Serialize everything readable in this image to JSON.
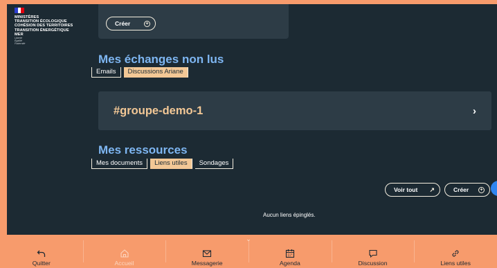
{
  "logo": {
    "lines": [
      "MINISTÈRES",
      "TRANSITION ÉCOLOGIQUE",
      "COHÉSION DES TERRITOIRES",
      "TRANSITION ÉNERGÉTIQUE",
      "MER"
    ],
    "motto": [
      "Liberté",
      "Égalité",
      "Fraternité"
    ],
    "flag_colors": [
      "#2d3fd1",
      "#ffffff",
      "#e1000f"
    ]
  },
  "top_card": {
    "create_label": "Créer"
  },
  "unread": {
    "title": "Mes échanges non lus",
    "tabs": [
      {
        "label": "Emails",
        "active": false
      },
      {
        "label": "Discussions Ariane",
        "active": true
      }
    ],
    "group_name": "#groupe-demo-1"
  },
  "resources": {
    "title": "Mes ressources",
    "tabs": [
      {
        "label": "Mes documents",
        "active": false
      },
      {
        "label": "Liens utiles",
        "active": true
      },
      {
        "label": "Sondages",
        "active": false
      }
    ],
    "view_all_label": "Voir tout",
    "create_label": "Créer",
    "empty_message": "Aucun liens épinglés."
  },
  "bottom_nav": [
    {
      "label": "Quitter",
      "icon": "back-arrow-icon",
      "disabled": false
    },
    {
      "label": "Accueil",
      "icon": "home-icon",
      "disabled": true
    },
    {
      "label": "Messagerie",
      "icon": "envelope-icon",
      "disabled": false
    },
    {
      "label": "Agenda",
      "icon": "calendar-icon",
      "disabled": false
    },
    {
      "label": "Discussion",
      "icon": "chat-icon",
      "disabled": false
    },
    {
      "label": "Liens utiles",
      "icon": "link-icon",
      "disabled": false
    }
  ],
  "colors": {
    "background": "#1c2a33",
    "card": "#2d3c46",
    "accent_orange": "#f79b6c",
    "accent_sand": "#f3c896",
    "title_blue": "#7eb6f2"
  }
}
